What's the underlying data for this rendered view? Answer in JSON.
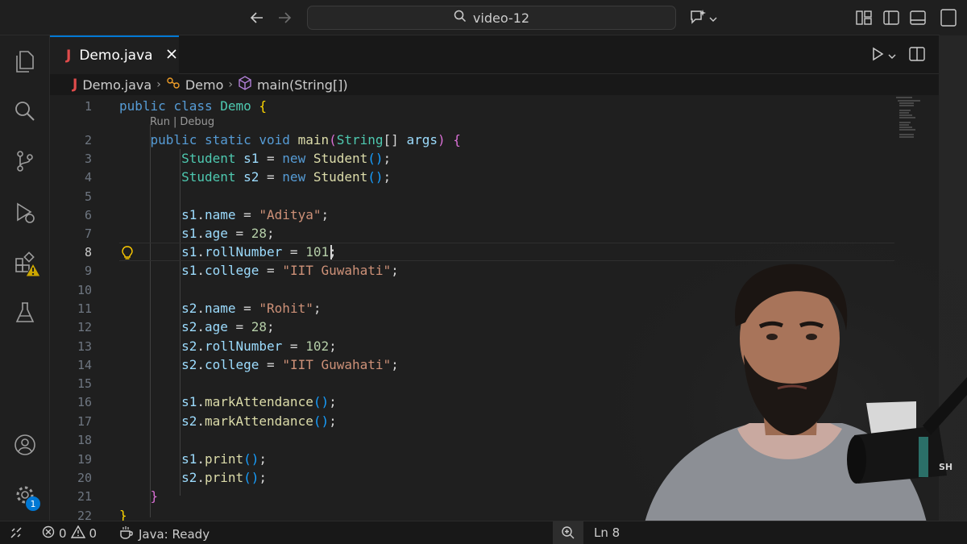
{
  "titlebar": {
    "search_text": "video-12"
  },
  "activity_bar": {
    "items": [
      "explorer",
      "search",
      "source-control",
      "run-and-debug",
      "extensions",
      "testing"
    ],
    "settings_badge": "1"
  },
  "tab": {
    "icon_letter": "J",
    "label": "Demo.java"
  },
  "breadcrumb": {
    "file": "Demo.java",
    "class": "Demo",
    "method": "main(String[])"
  },
  "editor": {
    "codelens_run": "Run",
    "codelens_sep": "|",
    "codelens_debug": "Debug",
    "active_line": 8,
    "lines": [
      {
        "n": "1",
        "tokens": [
          [
            "kw",
            "public "
          ],
          [
            "kw",
            "class "
          ],
          [
            "ty",
            "Demo "
          ],
          [
            "br3",
            "{"
          ]
        ]
      },
      {
        "n": "2",
        "tokens": [
          [
            "p",
            "    "
          ],
          [
            "kw",
            "public "
          ],
          [
            "kw",
            "static "
          ],
          [
            "kw",
            "void "
          ],
          [
            "fn",
            "main"
          ],
          [
            "br",
            "("
          ],
          [
            "ty",
            "String"
          ],
          [
            "p",
            "[] "
          ],
          [
            "vr",
            "args"
          ],
          [
            "br",
            ")"
          ],
          [
            "p",
            " "
          ],
          [
            "br",
            "{"
          ]
        ]
      },
      {
        "n": "3",
        "tokens": [
          [
            "p",
            "        "
          ],
          [
            "ty",
            "Student "
          ],
          [
            "vr",
            "s1"
          ],
          [
            "p",
            " = "
          ],
          [
            "kw",
            "new "
          ],
          [
            "fn",
            "Student"
          ],
          [
            "br2",
            "()"
          ],
          [
            "p",
            ";"
          ]
        ]
      },
      {
        "n": "4",
        "tokens": [
          [
            "p",
            "        "
          ],
          [
            "ty",
            "Student "
          ],
          [
            "vr",
            "s2"
          ],
          [
            "p",
            " = "
          ],
          [
            "kw",
            "new "
          ],
          [
            "fn",
            "Student"
          ],
          [
            "br2",
            "()"
          ],
          [
            "p",
            ";"
          ]
        ]
      },
      {
        "n": "5",
        "tokens": []
      },
      {
        "n": "6",
        "tokens": [
          [
            "p",
            "        "
          ],
          [
            "vr",
            "s1"
          ],
          [
            "p",
            "."
          ],
          [
            "vr",
            "name"
          ],
          [
            "p",
            " = "
          ],
          [
            "st",
            "\"Aditya\""
          ],
          [
            "p",
            ";"
          ]
        ]
      },
      {
        "n": "7",
        "tokens": [
          [
            "p",
            "        "
          ],
          [
            "vr",
            "s1"
          ],
          [
            "p",
            "."
          ],
          [
            "vr",
            "age"
          ],
          [
            "p",
            " = "
          ],
          [
            "nu",
            "28"
          ],
          [
            "p",
            ";"
          ]
        ]
      },
      {
        "n": "8",
        "tokens": [
          [
            "p",
            "        "
          ],
          [
            "vr",
            "s1"
          ],
          [
            "p",
            "."
          ],
          [
            "vr",
            "rollNumber"
          ],
          [
            "p",
            " = "
          ],
          [
            "nu",
            "101"
          ],
          [
            "p",
            ";"
          ]
        ]
      },
      {
        "n": "9",
        "tokens": [
          [
            "p",
            "        "
          ],
          [
            "vr",
            "s1"
          ],
          [
            "p",
            "."
          ],
          [
            "vr",
            "college"
          ],
          [
            "p",
            " = "
          ],
          [
            "st",
            "\"IIT Guwahati\""
          ],
          [
            "p",
            ";"
          ]
        ]
      },
      {
        "n": "10",
        "tokens": []
      },
      {
        "n": "11",
        "tokens": [
          [
            "p",
            "        "
          ],
          [
            "vr",
            "s2"
          ],
          [
            "p",
            "."
          ],
          [
            "vr",
            "name"
          ],
          [
            "p",
            " = "
          ],
          [
            "st",
            "\"Rohit\""
          ],
          [
            "p",
            ";"
          ]
        ]
      },
      {
        "n": "12",
        "tokens": [
          [
            "p",
            "        "
          ],
          [
            "vr",
            "s2"
          ],
          [
            "p",
            "."
          ],
          [
            "vr",
            "age"
          ],
          [
            "p",
            " = "
          ],
          [
            "nu",
            "28"
          ],
          [
            "p",
            ";"
          ]
        ]
      },
      {
        "n": "13",
        "tokens": [
          [
            "p",
            "        "
          ],
          [
            "vr",
            "s2"
          ],
          [
            "p",
            "."
          ],
          [
            "vr",
            "rollNumber"
          ],
          [
            "p",
            " = "
          ],
          [
            "nu",
            "102"
          ],
          [
            "p",
            ";"
          ]
        ]
      },
      {
        "n": "14",
        "tokens": [
          [
            "p",
            "        "
          ],
          [
            "vr",
            "s2"
          ],
          [
            "p",
            "."
          ],
          [
            "vr",
            "college"
          ],
          [
            "p",
            " = "
          ],
          [
            "st",
            "\"IIT Guwahati\""
          ],
          [
            "p",
            ";"
          ]
        ]
      },
      {
        "n": "15",
        "tokens": []
      },
      {
        "n": "16",
        "tokens": [
          [
            "p",
            "        "
          ],
          [
            "vr",
            "s1"
          ],
          [
            "p",
            "."
          ],
          [
            "fn",
            "markAttendance"
          ],
          [
            "br2",
            "()"
          ],
          [
            "p",
            ";"
          ]
        ]
      },
      {
        "n": "17",
        "tokens": [
          [
            "p",
            "        "
          ],
          [
            "vr",
            "s2"
          ],
          [
            "p",
            "."
          ],
          [
            "fn",
            "markAttendance"
          ],
          [
            "br2",
            "()"
          ],
          [
            "p",
            ";"
          ]
        ]
      },
      {
        "n": "18",
        "tokens": []
      },
      {
        "n": "19",
        "tokens": [
          [
            "p",
            "        "
          ],
          [
            "vr",
            "s1"
          ],
          [
            "p",
            "."
          ],
          [
            "fn",
            "print"
          ],
          [
            "br2",
            "()"
          ],
          [
            "p",
            ";"
          ]
        ]
      },
      {
        "n": "20",
        "tokens": [
          [
            "p",
            "        "
          ],
          [
            "vr",
            "s2"
          ],
          [
            "p",
            "."
          ],
          [
            "fn",
            "print"
          ],
          [
            "br2",
            "()"
          ],
          [
            "p",
            ";"
          ]
        ]
      },
      {
        "n": "21",
        "tokens": [
          [
            "p",
            "    "
          ],
          [
            "br",
            "}"
          ]
        ]
      },
      {
        "n": "22",
        "tokens": [
          [
            "br3",
            "}"
          ]
        ]
      }
    ]
  },
  "statusbar": {
    "errors": "0",
    "warnings": "0",
    "java_status": "Java: Ready",
    "cursor_position": "Ln 8"
  },
  "colors": {
    "accent": "#0078d4",
    "java_icon": "#e04b4b",
    "warning_badge": "#cca700"
  }
}
